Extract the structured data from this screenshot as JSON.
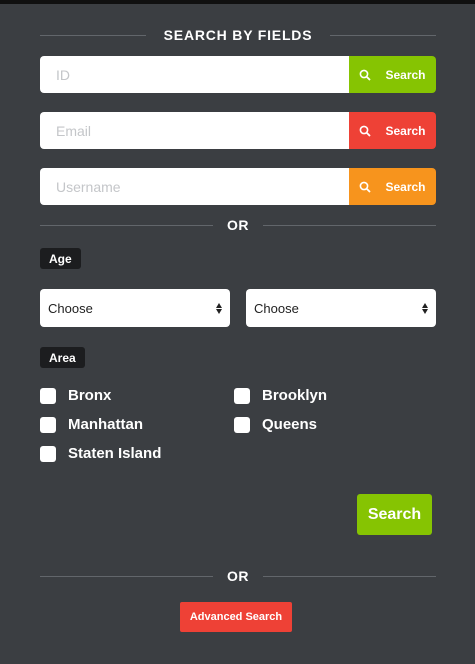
{
  "header": {
    "title": "SEARCH BY FIELDS"
  },
  "fields": [
    {
      "placeholder": "ID",
      "button_label": "Search",
      "color": "#86c402"
    },
    {
      "placeholder": "Email",
      "button_label": "Search",
      "color": "#ee4136"
    },
    {
      "placeholder": "Username",
      "button_label": "Search",
      "color": "#f7941d"
    }
  ],
  "or_label": "OR",
  "age": {
    "label": "Age",
    "from_value": "Choose",
    "to_value": "Choose"
  },
  "area": {
    "label": "Area",
    "options": [
      "Bronx",
      "Brooklyn",
      "Manhattan",
      "Queens",
      "Staten Island"
    ]
  },
  "search_button": "Search",
  "advanced_search_button": "Advanced Search",
  "colors": {
    "background": "#3b3e42",
    "green": "#86c402",
    "red": "#ee4136",
    "orange": "#f7941d",
    "tag": "#1c1d1f"
  }
}
